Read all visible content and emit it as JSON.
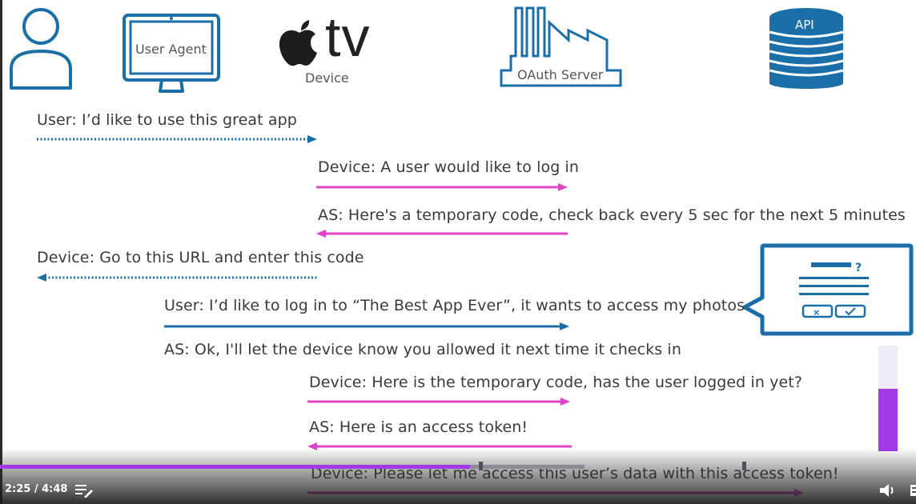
{
  "actors": {
    "user_agent_label": "User Agent",
    "device_brand": "tv",
    "device_label": "Device",
    "oauth_label": "OAuth Server",
    "api_label": "API"
  },
  "messages": [
    {
      "text": "User: I’d like to use this great app"
    },
    {
      "text": "Device: A user would like to log in"
    },
    {
      "text": "AS: Here's a temporary code, check back every 5 sec for the next 5 minutes"
    },
    {
      "text": "Device: Go to this URL and enter this code"
    },
    {
      "text": "User: I’d like to log in to “The Best App Ever”, it wants to access my photos"
    },
    {
      "text": "AS: Ok, I'll let the device know you allowed it next time it checks in"
    },
    {
      "text": "Device: Here is the temporary code, has the user logged in yet?"
    },
    {
      "text": "AS: Here is an access token!"
    },
    {
      "text": "Device: Please let me access this user’s data with this access token!"
    }
  ],
  "colors": {
    "blue": "#1a6fa8",
    "pink": "#e043c8",
    "accent_purple": "#a23ae8"
  },
  "player": {
    "time_display": "2:25 / 4:48",
    "played_fraction": 0.503,
    "volume_fraction": 0.59,
    "playlist_icon": "playlist-icon",
    "volume_icon": "volume-icon"
  }
}
